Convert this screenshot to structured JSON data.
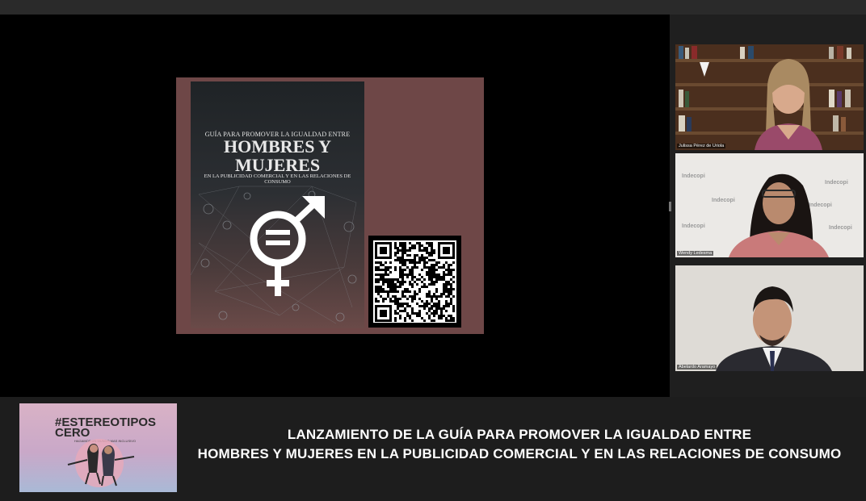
{
  "meeting": {
    "participants": [
      {
        "name": "Julissa Pérez de Uriola"
      },
      {
        "name": "Wendy Ledesma"
      },
      {
        "name": "Abelardo Aramayo"
      }
    ],
    "background_brand": "Indecopi"
  },
  "slide": {
    "cover": {
      "line1": "GUÍA PARA PROMOVER LA IGUALDAD ENTRE",
      "line2": "HOMBRES Y",
      "line3": "MUJERES",
      "line4": "EN LA PUBLICIDAD COMERCIAL Y EN LAS RELACIONES DE CONSUMO",
      "symbol": "equality-gender-icon"
    },
    "qr": "qr-code"
  },
  "banner": {
    "logo_hashtag_1": "#ESTEREOTIPOS",
    "logo_hashtag_2": "CERO",
    "logo_tagline": "HAGAMOS UN MUNDO MAS INCLUSIVO",
    "title_line1": "LANZAMIENTO DE LA GUÍA PARA PROMOVER LA IGUALDAD ENTRE",
    "title_line2": "HOMBRES Y MUJERES EN LA PUBLICIDAD COMERCIAL Y EN LAS RELACIONES DE CONSUMO"
  },
  "colors": {
    "slide_background": "#6e4747",
    "stage_background": "#000000",
    "bar_background": "#1d1d1d"
  }
}
